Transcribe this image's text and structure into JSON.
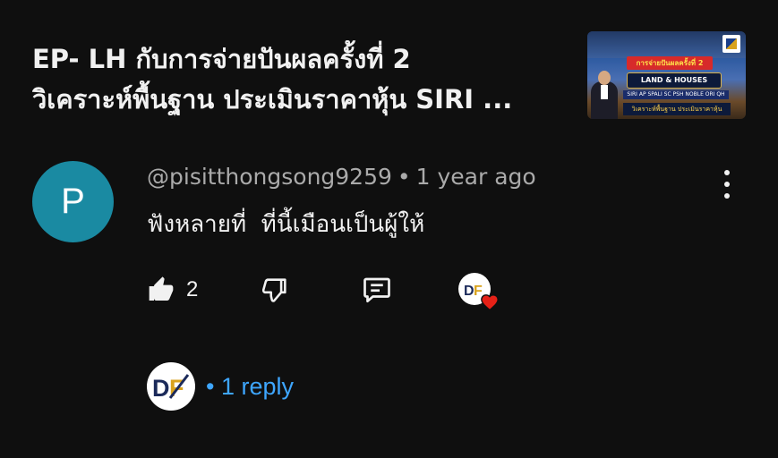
{
  "video": {
    "title_line1": "EP- LH กับการจ่ายปันผลครั้งที่ 2",
    "title_line2": "วิเคราะห์พื้นฐาน ประเมินราคาหุ้น SIRI ...",
    "thumbnail": {
      "banner_text": "การจ่ายปันผลครั้งที่ 2",
      "brand_text": "LAND & HOUSES",
      "tickers_text": "SIRI AP SPALI SC PSH NOBLE ORI QH",
      "subtitle_text": "วิเคราะห์พื้นฐาน ประเมินราคาหุ้น"
    }
  },
  "comment": {
    "avatar_letter": "P",
    "avatar_color": "#1a8aa2",
    "author": "@pisitthongsong9259",
    "separator": "•",
    "time": "1 year ago",
    "text": "ฟังหลายที่  ที่นี้เมือนเป็นผู้ให้",
    "like_count": "2"
  },
  "replies": {
    "prefix": "•",
    "label": "1 reply",
    "link_color": "#3ea6ff"
  },
  "icons": {
    "like": "thumbs-up-icon",
    "dislike": "thumbs-down-icon",
    "reply": "comment-icon",
    "menu": "more-vertical-icon",
    "creator_heart": "heart-icon"
  }
}
